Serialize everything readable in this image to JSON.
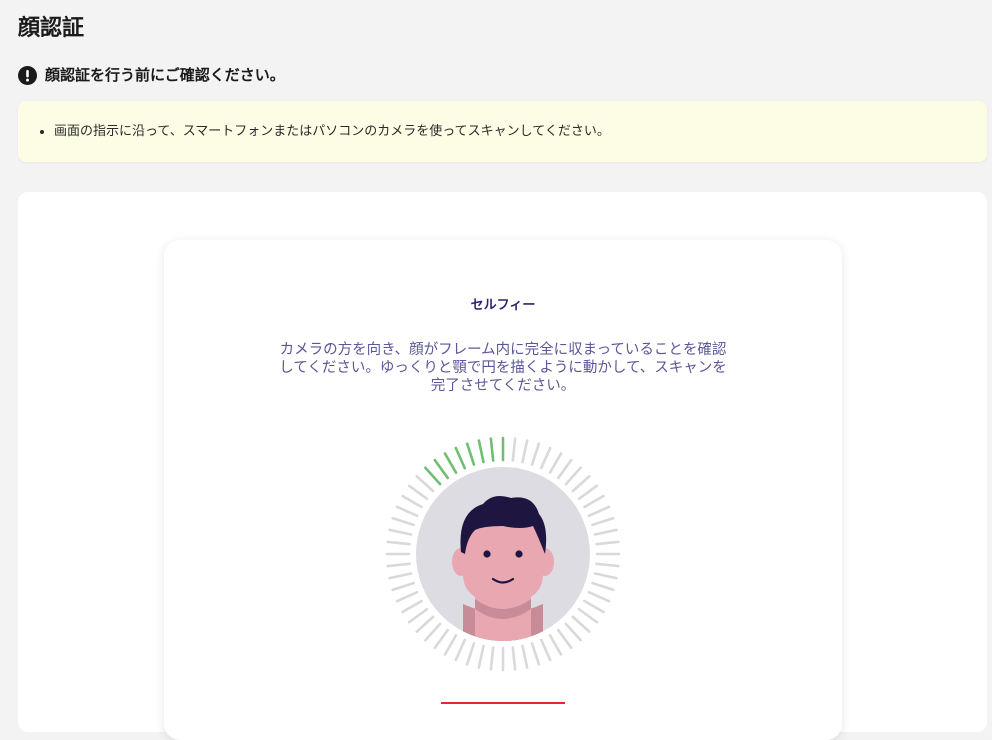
{
  "page": {
    "title": "顔認証"
  },
  "notice": {
    "heading": "顔認証を行う前にご確認ください。",
    "items": [
      "画面の指示に沿って、スマートフォンまたはパソコンのカメラを使ってスキャンしてください。"
    ]
  },
  "scan": {
    "title": "セルフィー",
    "instructions": "カメラの方を向き、顔がフレーム内に完全に収まっていることを確認してください。ゆっくりと顎で円を描くように動かして、スキャンを完了させてください。",
    "progress_ticks_total": 60,
    "progress_ticks_done": 8
  },
  "colors": {
    "tick_done": "#6fbf73",
    "tick_pending": "#d9d9d9",
    "face_bg": "#dcdce2",
    "skin": "#e9a7b2",
    "hair": "#1e1640",
    "accent_button": "#e8262e"
  },
  "icons": {
    "alert": "alert-circle-icon",
    "avatar": "face-avatar-icon"
  }
}
